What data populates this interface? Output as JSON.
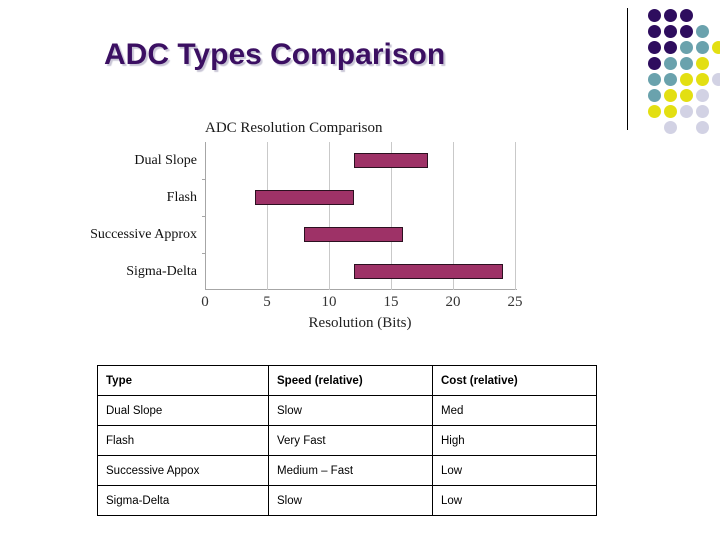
{
  "slide": {
    "title": "ADC Types Comparison",
    "title_color": "#3b0f62"
  },
  "decor": {
    "divider_name": "corner-divider",
    "colors": {
      "purple": "#2e0d5e",
      "teal": "#6aa2ad",
      "yellow": "#e3df12",
      "lavender": "#d2d2e4"
    },
    "dots": [
      {
        "col": 0,
        "row": 0,
        "color": "#2e0d5e"
      },
      {
        "col": 1,
        "row": 0,
        "color": "#2e0d5e"
      },
      {
        "col": 2,
        "row": 0,
        "color": "#2e0d5e"
      },
      {
        "col": 0,
        "row": 1,
        "color": "#2e0d5e"
      },
      {
        "col": 1,
        "row": 1,
        "color": "#2e0d5e"
      },
      {
        "col": 2,
        "row": 1,
        "color": "#2e0d5e"
      },
      {
        "col": 3,
        "row": 1,
        "color": "#6aa2ad"
      },
      {
        "col": 0,
        "row": 2,
        "color": "#2e0d5e"
      },
      {
        "col": 1,
        "row": 2,
        "color": "#2e0d5e"
      },
      {
        "col": 2,
        "row": 2,
        "color": "#6aa2ad"
      },
      {
        "col": 3,
        "row": 2,
        "color": "#6aa2ad"
      },
      {
        "col": 4,
        "row": 2,
        "color": "#e3df12"
      },
      {
        "col": 0,
        "row": 3,
        "color": "#2e0d5e"
      },
      {
        "col": 1,
        "row": 3,
        "color": "#6aa2ad"
      },
      {
        "col": 2,
        "row": 3,
        "color": "#6aa2ad"
      },
      {
        "col": 3,
        "row": 3,
        "color": "#e3df12"
      },
      {
        "col": 0,
        "row": 4,
        "color": "#6aa2ad"
      },
      {
        "col": 1,
        "row": 4,
        "color": "#6aa2ad"
      },
      {
        "col": 2,
        "row": 4,
        "color": "#e3df12"
      },
      {
        "col": 3,
        "row": 4,
        "color": "#e3df12"
      },
      {
        "col": 4,
        "row": 4,
        "color": "#d2d2e4"
      },
      {
        "col": 0,
        "row": 5,
        "color": "#6aa2ad"
      },
      {
        "col": 1,
        "row": 5,
        "color": "#e3df12"
      },
      {
        "col": 2,
        "row": 5,
        "color": "#e3df12"
      },
      {
        "col": 3,
        "row": 5,
        "color": "#d2d2e4"
      },
      {
        "col": 0,
        "row": 6,
        "color": "#e3df12"
      },
      {
        "col": 1,
        "row": 6,
        "color": "#e3df12"
      },
      {
        "col": 2,
        "row": 6,
        "color": "#d2d2e4"
      },
      {
        "col": 3,
        "row": 6,
        "color": "#d2d2e4"
      },
      {
        "col": 1,
        "row": 7,
        "color": "#d2d2e4"
      },
      {
        "col": 3,
        "row": 7,
        "color": "#d2d2e4"
      }
    ]
  },
  "chart_data": {
    "type": "bar",
    "orientation": "horizontal",
    "subtype": "floating-range",
    "title": "ADC Resolution Comparison",
    "xlabel": "Resolution (Bits)",
    "ylabel": "",
    "categories": [
      "Dual Slope",
      "Flash",
      "Successive Approx",
      "Sigma-Delta"
    ],
    "ranges": [
      {
        "category": "Dual Slope",
        "start": 12,
        "end": 18
      },
      {
        "category": "Flash",
        "start": 4,
        "end": 12
      },
      {
        "category": "Successive Approx",
        "start": 8,
        "end": 16
      },
      {
        "category": "Sigma-Delta",
        "start": 12,
        "end": 24
      }
    ],
    "xlim": [
      0,
      25
    ],
    "xticks": [
      0,
      5,
      10,
      15,
      20,
      25
    ],
    "xtick_labels": [
      "0",
      "5",
      "10",
      "15",
      "20",
      "25"
    ],
    "grid": true,
    "legend": false,
    "bar_color": "#9e3267",
    "bar_border_color": "#2b1020"
  },
  "table": {
    "headers": [
      "Type",
      "Speed (relative)",
      "Cost (relative)"
    ],
    "rows": [
      [
        "Dual Slope",
        "Slow",
        "Med"
      ],
      [
        "Flash",
        "Very Fast",
        "High"
      ],
      [
        "Successive Appox",
        "Medium – Fast",
        "Low"
      ],
      [
        "Sigma-Delta",
        "Slow",
        "Low"
      ]
    ]
  }
}
